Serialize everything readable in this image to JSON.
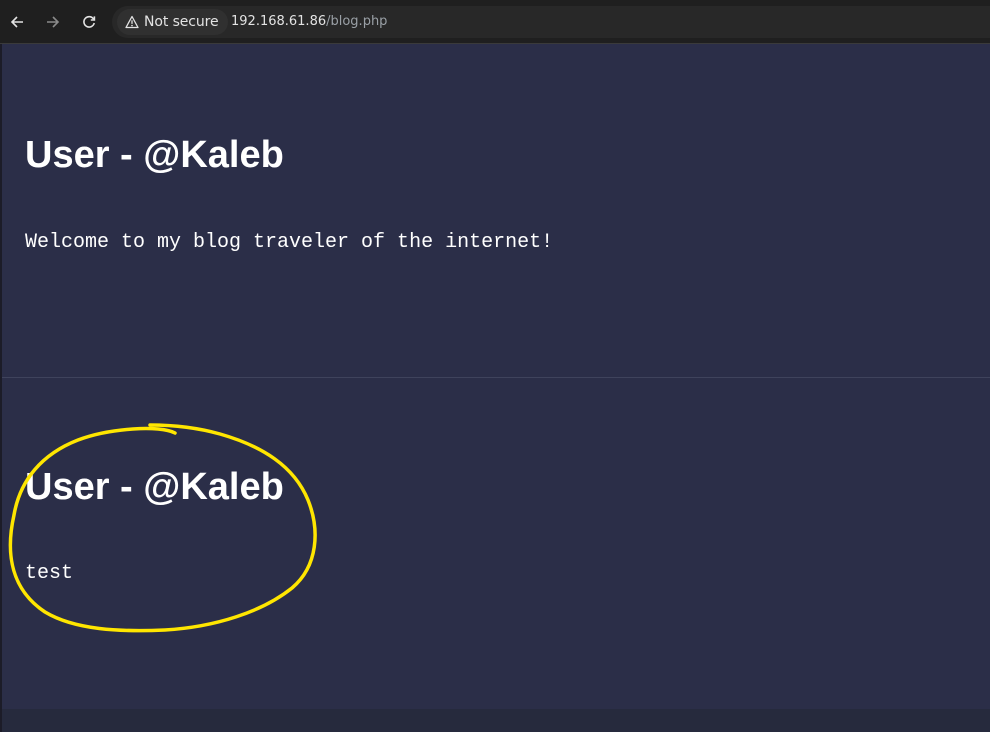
{
  "browser": {
    "security_label": "Not secure",
    "url_host": "192.168.61.86",
    "url_path": "/blog.php",
    "icons": {
      "back": "arrow-left-icon",
      "forward": "arrow-right-icon",
      "reload": "reload-icon",
      "security": "warning-triangle-icon"
    }
  },
  "posts": [
    {
      "title": "User - @Kaleb",
      "body": "Welcome to my blog traveler of the internet!"
    },
    {
      "title": "User - @Kaleb",
      "body": "test"
    }
  ],
  "colors": {
    "page_background": "#2b2e48",
    "text": "#ffffff",
    "annotation": "#ffe600",
    "browser_bar": "#1f1f1f"
  }
}
